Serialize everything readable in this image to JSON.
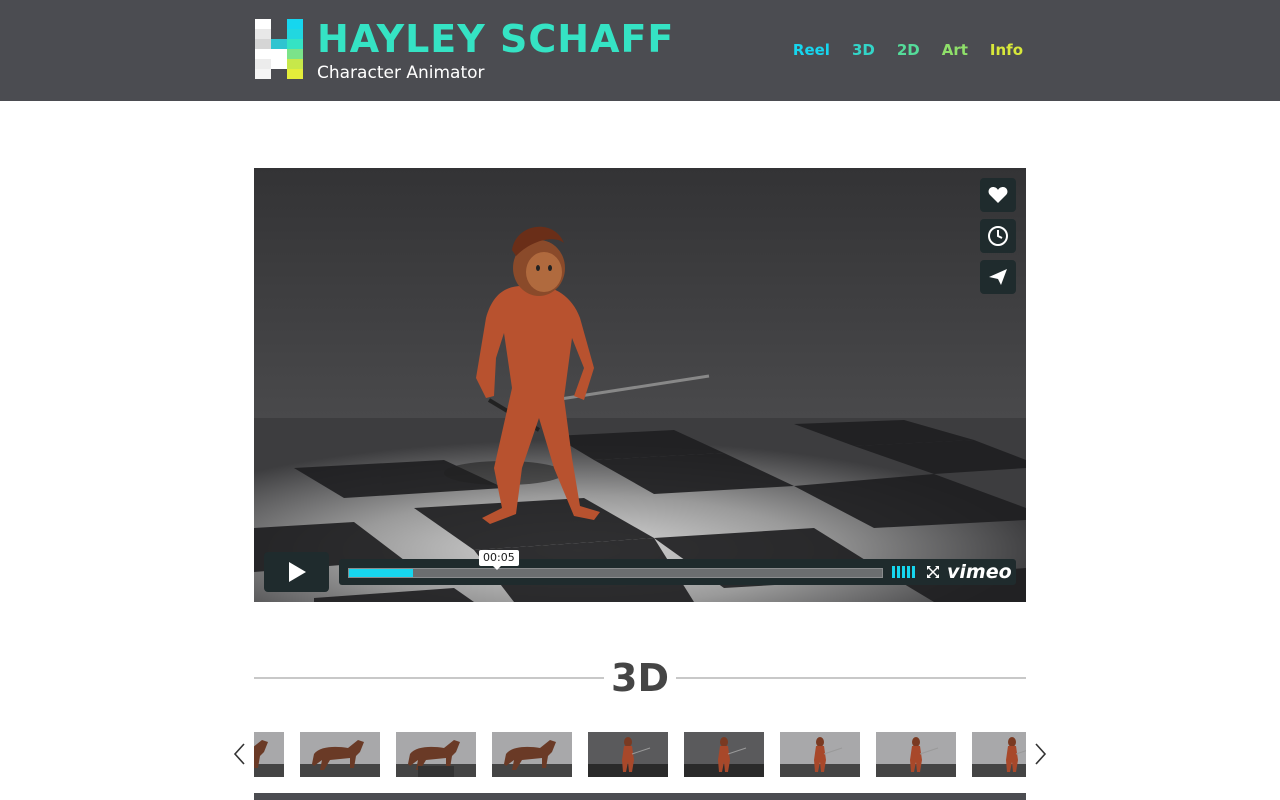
{
  "brand": {
    "name": "HAYLEY SCHAFF",
    "subtitle": "Character Animator"
  },
  "nav": [
    {
      "label": "Reel",
      "color": "#16d6ef"
    },
    {
      "label": "3D",
      "color": "#33d5c8"
    },
    {
      "label": "2D",
      "color": "#55dc9a"
    },
    {
      "label": "Art",
      "color": "#8fe06a"
    },
    {
      "label": "Info",
      "color": "#d8e83a"
    }
  ],
  "video": {
    "timestamp": "00:05",
    "progress_fraction": 0.12,
    "provider": "vimeo",
    "side_buttons": [
      "heart-icon",
      "clock-icon",
      "send-icon"
    ]
  },
  "section": {
    "title": "3D"
  },
  "carousel": {
    "thumbnails": [
      {
        "subject": "horse",
        "scheme": "gray"
      },
      {
        "subject": "horse",
        "scheme": "gray"
      },
      {
        "subject": "horse-jump",
        "scheme": "gray"
      },
      {
        "subject": "horse",
        "scheme": "gray"
      },
      {
        "subject": "character",
        "scheme": "dark"
      },
      {
        "subject": "character",
        "scheme": "dark"
      },
      {
        "subject": "character",
        "scheme": "gray"
      },
      {
        "subject": "character",
        "scheme": "gray"
      },
      {
        "subject": "character",
        "scheme": "gray"
      }
    ]
  },
  "colors": {
    "header_bg": "#4b4c51",
    "accent_teal": "#35e3c4",
    "accent_cyan": "#16d6ef"
  }
}
